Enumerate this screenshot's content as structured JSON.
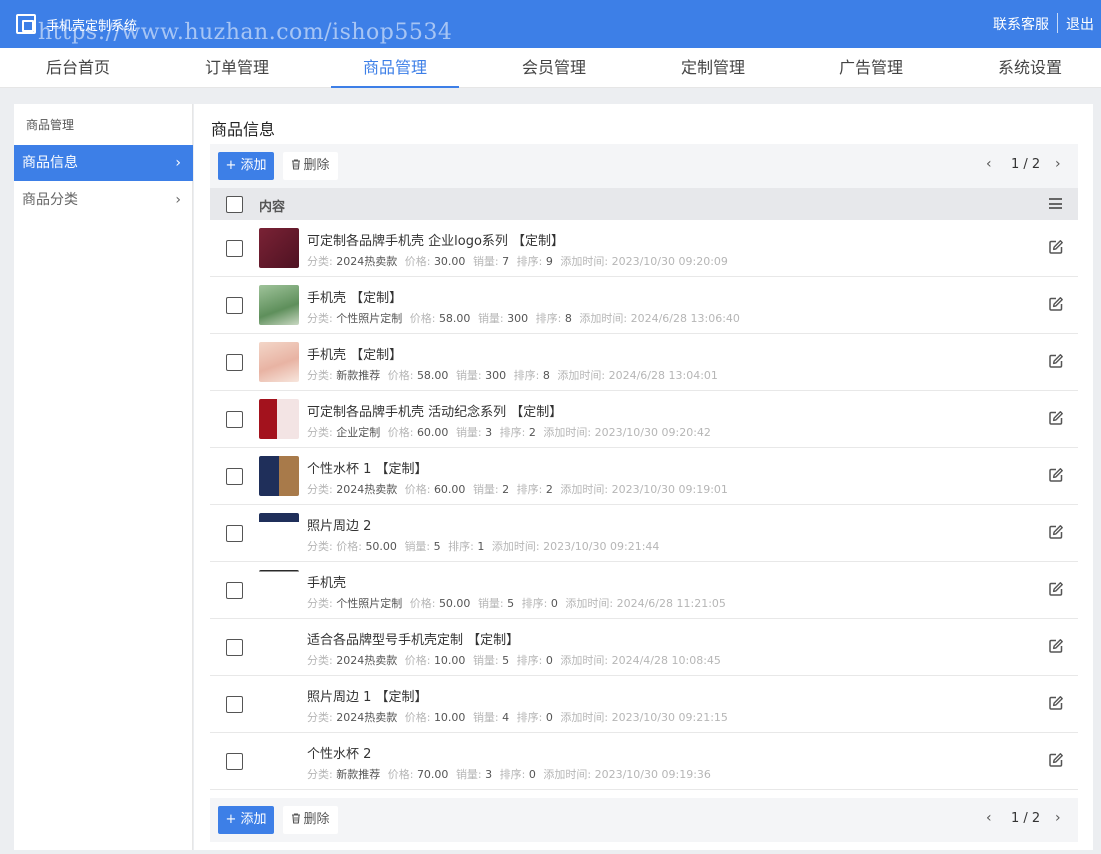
{
  "header": {
    "app_title": "手机壳定制系统",
    "watermark": "https://www.huzhan.com/ishop5534",
    "contact_link": "联系客服",
    "logout_link": "退出"
  },
  "nav": {
    "items": [
      "后台首页",
      "订单管理",
      "商品管理",
      "会员管理",
      "定制管理",
      "广告管理",
      "系统设置"
    ],
    "active_index": 2
  },
  "sidebar": {
    "title": "商品管理",
    "items": [
      {
        "label": "商品信息",
        "active": true
      },
      {
        "label": "商品分类",
        "active": false
      }
    ],
    "chevron": "›"
  },
  "main": {
    "title": "商品信息",
    "toolbar": {
      "add_label": "+ 添加",
      "delete_label": "删除",
      "pager_text": "1 / 2",
      "prev": "‹",
      "next": "›"
    },
    "table_header": "内容",
    "meta_labels": {
      "category": "分类:",
      "price": "价格:",
      "sales": "销量:",
      "order": "排序:",
      "added": "添加时间:"
    },
    "rows": [
      {
        "title": "可定制各品牌手机壳 企业logo系列 【定制】",
        "category": "2024热卖款",
        "price": "30.00",
        "sales": "7",
        "order": "9",
        "added": "2023/10/30 09:20:09",
        "thumb": "maroon"
      },
      {
        "title": "手机壳 【定制】",
        "category": "个性照片定制",
        "price": "58.00",
        "sales": "300",
        "order": "8",
        "added": "2024/6/28 13:06:40",
        "thumb": "green"
      },
      {
        "title": "手机壳 【定制】",
        "category": "新款推荐",
        "price": "58.00",
        "sales": "300",
        "order": "8",
        "added": "2024/6/28 13:04:01",
        "thumb": "peach"
      },
      {
        "title": "可定制各品牌手机壳 活动纪念系列 【定制】",
        "category": "企业定制",
        "price": "60.00",
        "sales": "3",
        "order": "2",
        "added": "2023/10/30 09:20:42",
        "thumb": "red"
      },
      {
        "title": "个性水杯 1 【定制】",
        "category": "2024热卖款",
        "price": "60.00",
        "sales": "2",
        "order": "2",
        "added": "2023/10/30 09:19:01",
        "thumb": "navy"
      },
      {
        "title": "照片周边 2",
        "category": "",
        "price": "50.00",
        "sales": "5",
        "order": "1",
        "added": "2023/10/30 09:21:44",
        "thumb": "navy-strip"
      },
      {
        "title": "手机壳",
        "category": "个性照片定制",
        "price": "50.00",
        "sales": "5",
        "order": "0",
        "added": "2024/6/28 11:21:05",
        "thumb": "thin-strip"
      },
      {
        "title": "适合各品牌型号手机壳定制 【定制】",
        "category": "2024热卖款",
        "price": "10.00",
        "sales": "5",
        "order": "0",
        "added": "2024/4/28 10:08:45",
        "thumb": "none"
      },
      {
        "title": "照片周边 1 【定制】",
        "category": "2024热卖款",
        "price": "10.00",
        "sales": "4",
        "order": "0",
        "added": "2023/10/30 09:21:15",
        "thumb": "none"
      },
      {
        "title": "个性水杯 2",
        "category": "新款推荐",
        "price": "70.00",
        "sales": "3",
        "order": "0",
        "added": "2023/10/30 09:19:36",
        "thumb": "none"
      }
    ]
  },
  "colors": {
    "primary": "#3d7fe7",
    "header_bg": "#3d7fe7",
    "page_bg": "#eceef1"
  },
  "icons": [
    "logo-icon",
    "add-icon",
    "trash-icon",
    "chevron-left-icon",
    "chevron-right-icon",
    "menu-icon",
    "edit-icon"
  ]
}
